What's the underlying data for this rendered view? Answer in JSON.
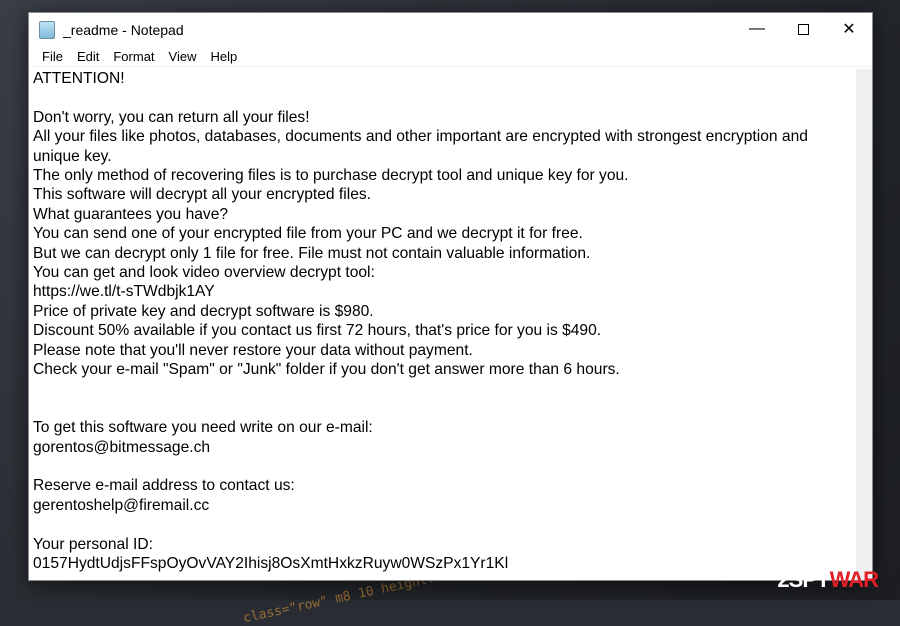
{
  "window": {
    "title": "_readme - Notepad",
    "controls": [
      "minimize",
      "maximize",
      "close"
    ]
  },
  "menu": [
    "File",
    "Edit",
    "Format",
    "View",
    "Help"
  ],
  "lines": [
    "ATTENTION!",
    "",
    "Don't worry, you can return all your files!",
    "All your files like photos, databases, documents and other important are encrypted with strongest encryption and unique key.",
    "The only method of recovering files is to purchase decrypt tool and unique key for you.",
    "This software will decrypt all your encrypted files.",
    "What guarantees you have?",
    "You can send one of your encrypted file from your PC and we decrypt it for free.",
    "But we can decrypt only 1 file for free. File must not contain valuable information.",
    "You can get and look video overview decrypt tool:",
    "https://we.tl/t-sTWdbjk1AY",
    "Price of private key and decrypt software is $980.",
    "Discount 50% available if you contact us first 72 hours, that's price for you is $490.",
    "Please note that you'll never restore your data without payment.",
    "Check your e-mail \"Spam\" or \"Junk\" folder if you don't get answer more than 6 hours.",
    "",
    "",
    "To get this software you need write on our e-mail:",
    "gorentos@bitmessage.ch",
    "",
    "Reserve e-mail address to contact us:",
    "gerentoshelp@firemail.cc",
    "",
    "Your personal ID:",
    "0157HydtUdjsFFspOyOvVAY2Ihisj8OsXmtHxkzRuyw0WSzPx1Yr1Kl"
  ],
  "watermark": {
    "part1": "2SPY",
    "part2": "WAR",
    "accent": "#e01f26"
  }
}
